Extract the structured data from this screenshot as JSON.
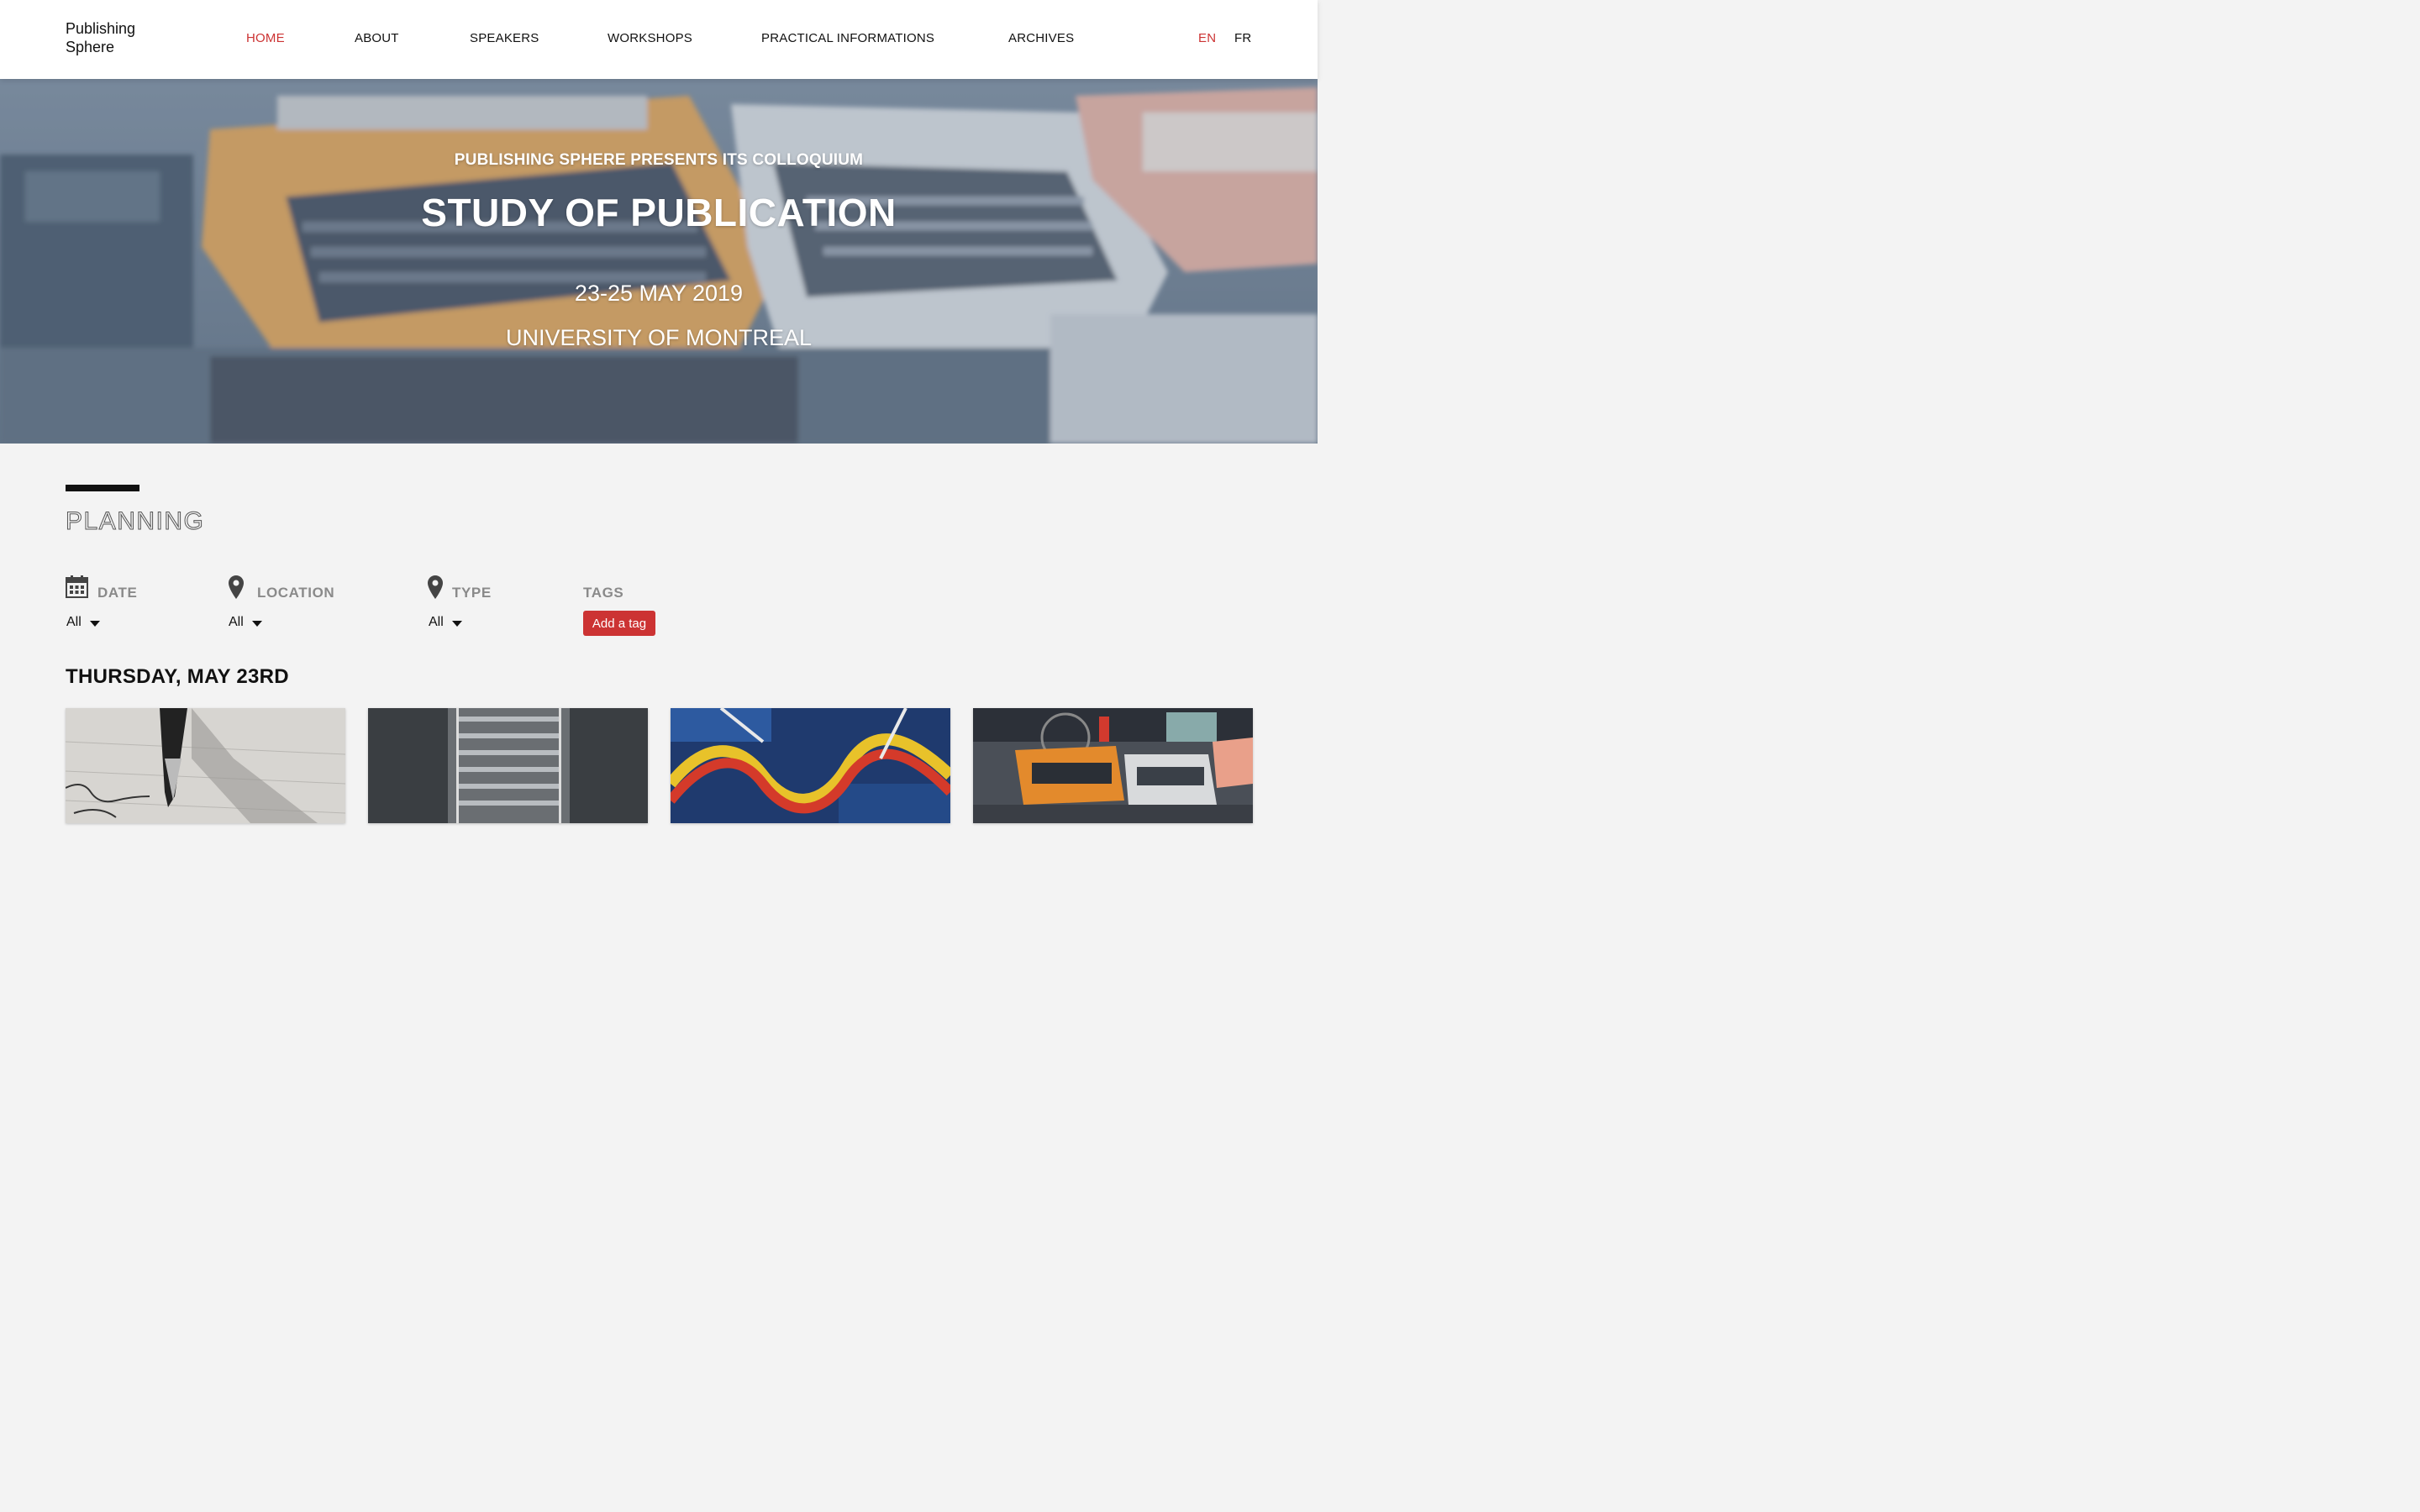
{
  "header": {
    "logo_line1": "Publishing",
    "logo_line2": "Sphere",
    "nav": [
      "HOME",
      "ABOUT",
      "SPEAKERS",
      "WORKSHOPS",
      "PRACTICAL INFORMATIONS",
      "ARCHIVES"
    ],
    "active_nav": "HOME",
    "languages": [
      "EN",
      "FR"
    ],
    "active_language": "EN"
  },
  "hero": {
    "subtitle": "PUBLISHING SPHERE PRESENTS ITS COLLOQUIUM",
    "title": "STUDY OF PUBLICATION",
    "dates": "23-25 MAY 2019",
    "location": "UNIVERSITY OF MONTREAL"
  },
  "planning": {
    "title": "PLANNING",
    "filters": {
      "date": {
        "label": "DATE",
        "value": "All",
        "icon": "calendar-icon"
      },
      "location": {
        "label": "LOCATION",
        "value": "All",
        "icon": "map-pin-icon"
      },
      "type": {
        "label": "TYPE",
        "value": "All",
        "icon": "map-pin-icon"
      },
      "tags": {
        "label": "TAGS",
        "button": "Add a tag"
      }
    },
    "day_heading": "THURSDAY, MAY 23RD",
    "cards": [
      {
        "image": "fountain-pen-writing"
      },
      {
        "image": "stairs-between-walls"
      },
      {
        "image": "abstract-painting-waves"
      },
      {
        "image": "typewriters-on-table"
      }
    ]
  },
  "colors": {
    "accent": "#cc3333",
    "background": "#f3f3f3",
    "header_bg": "#ffffff",
    "text": "#111111",
    "muted": "#8a8a8a"
  }
}
